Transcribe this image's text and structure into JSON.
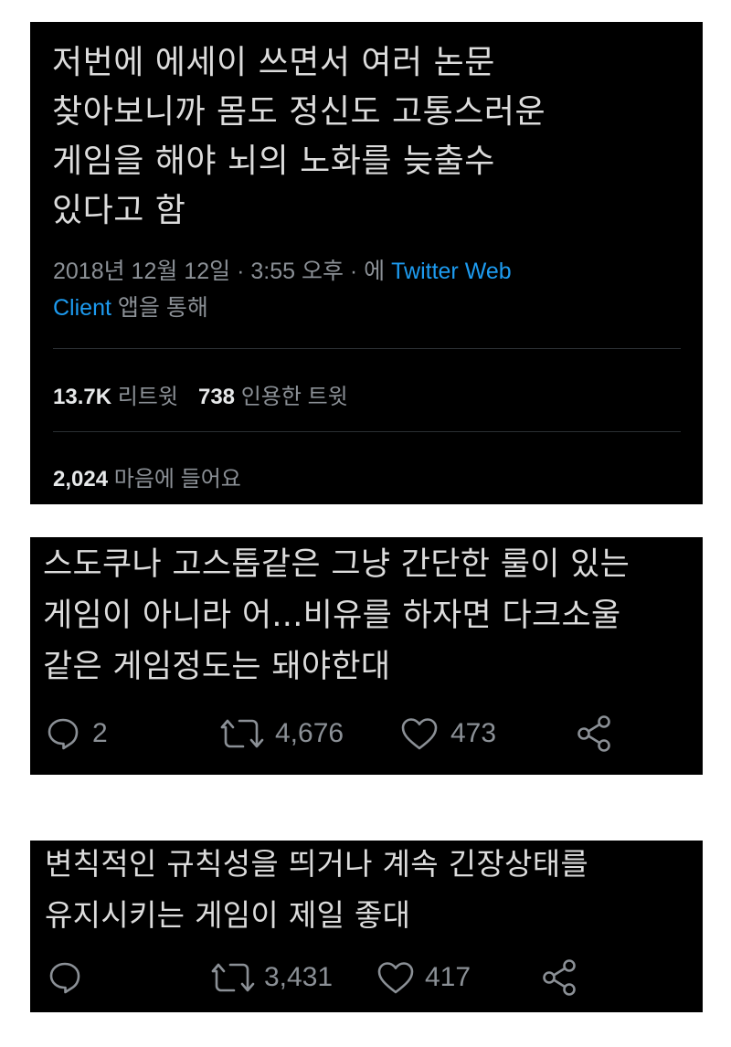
{
  "main_tweet": {
    "text_lines": [
      "저번에 에세이 쓰면서 여러 논문",
      "찾아보니까 몸도 정신도 고통스러운",
      "게임을 해야 뇌의 노화를 늦출수",
      "있다고 함"
    ],
    "timestamp": "2018년 12월 12일 · 3:55 오후 · 에",
    "client_link_line1": "Twitter Web",
    "client_link_line2": "Client",
    "via_suffix": "앱을 통해",
    "retweet_count": "13.7K",
    "retweet_label": "리트윗",
    "quote_count": "738",
    "quote_label": "인용한 트윗",
    "like_count": "2,024",
    "like_label": "마음에 들어요"
  },
  "reply_1": {
    "text_lines": [
      "스도쿠나 고스톱같은 그냥 간단한 룰이 있는",
      "게임이 아니라 어...비유를 하자면 다크소울",
      "같은 게임정도는 돼야한대"
    ],
    "reply_count": "2",
    "retweet_count": "4,676",
    "like_count": "473"
  },
  "reply_2": {
    "text_lines": [
      "변칙적인 규칙성을 띄거나 계속 긴장상태를",
      "유지시키는 게임이 제일 좋대"
    ],
    "reply_count": "",
    "retweet_count": "3,431",
    "like_count": "417"
  },
  "icons": [
    "reply-icon",
    "retweet-icon",
    "like-icon",
    "share-icon"
  ],
  "colors": {
    "background": "#000000",
    "text": "#dcdcdc",
    "muted": "#8b9096",
    "link": "#1d9bf0"
  }
}
